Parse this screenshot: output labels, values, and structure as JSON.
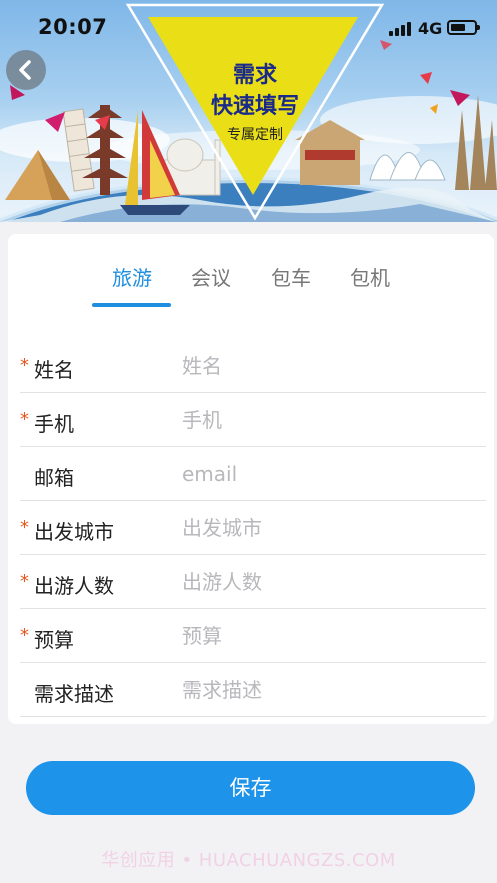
{
  "status_bar": {
    "time": "20:07",
    "network": "4G"
  },
  "banner": {
    "line1": "需求",
    "line2": "快速填写",
    "line3": "专属定制"
  },
  "tabs": [
    {
      "label": "旅游",
      "active": true
    },
    {
      "label": "会议",
      "active": false
    },
    {
      "label": "包车",
      "active": false
    },
    {
      "label": "包机",
      "active": false
    }
  ],
  "form": {
    "fields": [
      {
        "label": "姓名",
        "placeholder": "姓名",
        "required": true,
        "value": ""
      },
      {
        "label": "手机",
        "placeholder": "手机",
        "required": true,
        "value": ""
      },
      {
        "label": "邮箱",
        "placeholder": "email",
        "required": false,
        "value": ""
      },
      {
        "label": "出发城市",
        "placeholder": "出发城市",
        "required": true,
        "value": ""
      },
      {
        "label": "出游人数",
        "placeholder": "出游人数",
        "required": true,
        "value": ""
      },
      {
        "label": "预算",
        "placeholder": "预算",
        "required": true,
        "value": ""
      },
      {
        "label": "需求描述",
        "placeholder": "需求描述",
        "required": false,
        "value": ""
      }
    ],
    "required_mark": "*",
    "save_label": "保存"
  },
  "watermark": "华创应用 • HUACHUANGZS.COM",
  "colors": {
    "accent": "#1e8fe0",
    "required": "#e8571e",
    "triangle": "#eadf16"
  },
  "icons": {
    "back": "chevron-left-icon",
    "signal": "signal-icon",
    "battery": "battery-icon"
  }
}
